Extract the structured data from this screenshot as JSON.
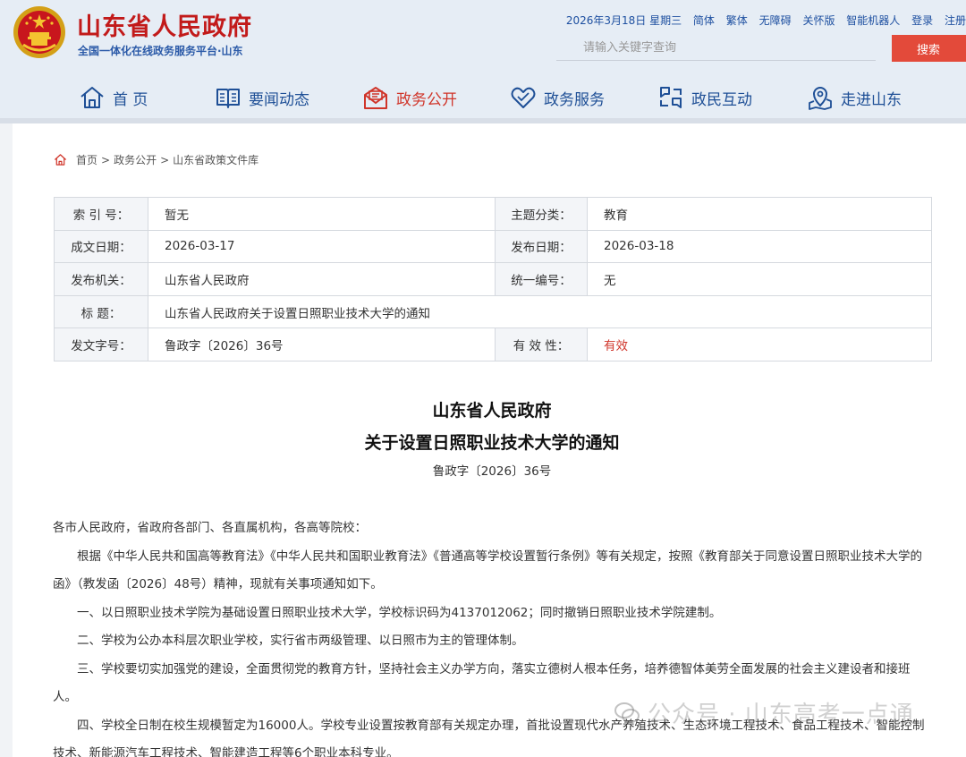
{
  "header": {
    "site_title": "山东省人民政府",
    "site_subtitle": "全国一体化在线政务服务平台·山东",
    "date": "2026年3月18日 星期三",
    "top_links": [
      "简体",
      "繁体",
      "无障碍",
      "关怀版",
      "智能机器人",
      "登录",
      "注册"
    ],
    "search_placeholder": "请输入关键字查询",
    "search_button": "搜索"
  },
  "nav": {
    "items": [
      {
        "label": "首 页",
        "icon": "home-icon"
      },
      {
        "label": "要闻动态",
        "icon": "newspaper-icon"
      },
      {
        "label": "政务公开",
        "icon": "mail-open-icon",
        "active": true
      },
      {
        "label": "政务服务",
        "icon": "heart-hand-icon"
      },
      {
        "label": "政民互动",
        "icon": "interaction-icon"
      },
      {
        "label": "走进山东",
        "icon": "map-pin-icon"
      }
    ]
  },
  "breadcrumb": [
    "首页",
    "政务公开",
    "山东省政策文件库"
  ],
  "meta": {
    "rows": [
      {
        "k1": "索 引 号：",
        "v1": "暂无",
        "k2": "主题分类：",
        "v2": "教育"
      },
      {
        "k1": "成文日期：",
        "v1": "2026-03-17",
        "k2": "发布日期：",
        "v2": "2026-03-18"
      },
      {
        "k1": "发布机关：",
        "v1": "山东省人民政府",
        "k2": "统一编号：",
        "v2": "无"
      },
      {
        "k1": "标 题：",
        "v1": "山东省人民政府关于设置日照职业技术大学的通知"
      },
      {
        "k1": "发文字号：",
        "v1": "鲁政字〔2026〕36号",
        "k2": "有 效 性：",
        "v2": "有效"
      }
    ]
  },
  "article": {
    "title_line1": "山东省人民政府",
    "title_line2": "关于设置日照职业技术大学的通知",
    "doc_number": "鲁政字〔2026〕36号",
    "paragraphs": [
      "各市人民政府，省政府各部门、各直属机构，各高等院校：",
      "根据《中华人民共和国高等教育法》《中华人民共和国职业教育法》《普通高等学校设置暂行条例》等有关规定，按照《教育部关于同意设置日照职业技术大学的函》（教发函〔2026〕48号）精神，现就有关事项通知如下。",
      "一、以日照职业技术学院为基础设置日照职业技术大学，学校标识码为4137012062；同时撤销日照职业技术学院建制。",
      "二、学校为公办本科层次职业学校，实行省市两级管理、以日照市为主的管理体制。",
      "三、学校要切实加强党的建设，全面贯彻党的教育方针，坚持社会主义办学方向，落实立德树人根本任务，培养德智体美劳全面发展的社会主义建设者和接班人。",
      "四、学校全日制在校生规模暂定为16000人。学校专业设置按教育部有关规定办理，首批设置现代水产养殖技术、生态环境工程技术、食品工程技术、智能控制技术、新能源汽车工程技术、智能建造工程等6个职业本科专业。"
    ]
  },
  "watermark": "公众号 · 山东高考一点通",
  "colors": {
    "brand_red": "#c21a1a",
    "nav_blue": "#1e4f96",
    "active_red": "#d0352a",
    "search_button": "#e34a3a"
  }
}
